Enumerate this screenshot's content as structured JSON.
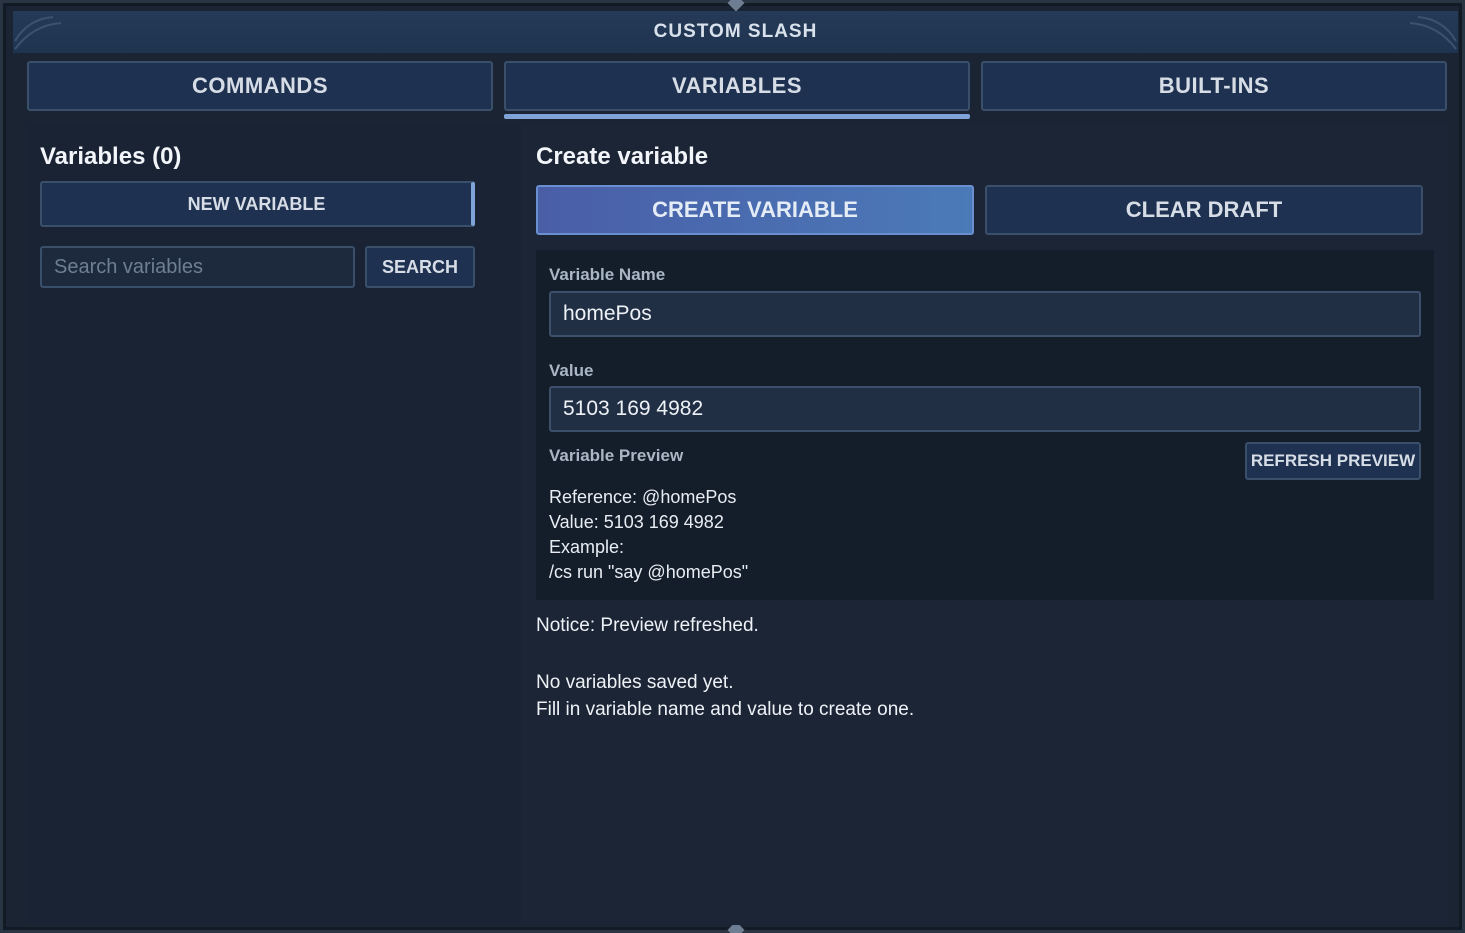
{
  "window": {
    "title": "CUSTOM SLASH"
  },
  "tabs": [
    {
      "label": "COMMANDS",
      "active": false
    },
    {
      "label": "VARIABLES",
      "active": true
    },
    {
      "label": "BUILT-INS",
      "active": false
    }
  ],
  "left": {
    "heading": "Variables (0)",
    "new_variable_label": "NEW VARIABLE",
    "search": {
      "placeholder": "Search variables",
      "value": ""
    },
    "search_button_label": "SEARCH"
  },
  "right": {
    "heading": "Create variable",
    "create_button_label": "CREATE VARIABLE",
    "clear_button_label": "CLEAR DRAFT",
    "name_label": "Variable Name",
    "name_value": "homePos",
    "value_label": "Value",
    "value_value": "5103 169 4982",
    "preview_label": "Variable Preview",
    "refresh_button_label": "REFRESH PREVIEW",
    "preview_lines": [
      "Reference: @homePos",
      "Value: 5103 169 4982",
      "Example:",
      "/cs run \"say @homePos\""
    ],
    "notice": "Notice: Preview refreshed.",
    "empty_lines": [
      "No variables saved yet.",
      "Fill in variable name and value to create one."
    ]
  },
  "colors": {
    "accent": "#7fa3d6",
    "primary_button": "#4a5ea8",
    "background": "#1a2433"
  }
}
